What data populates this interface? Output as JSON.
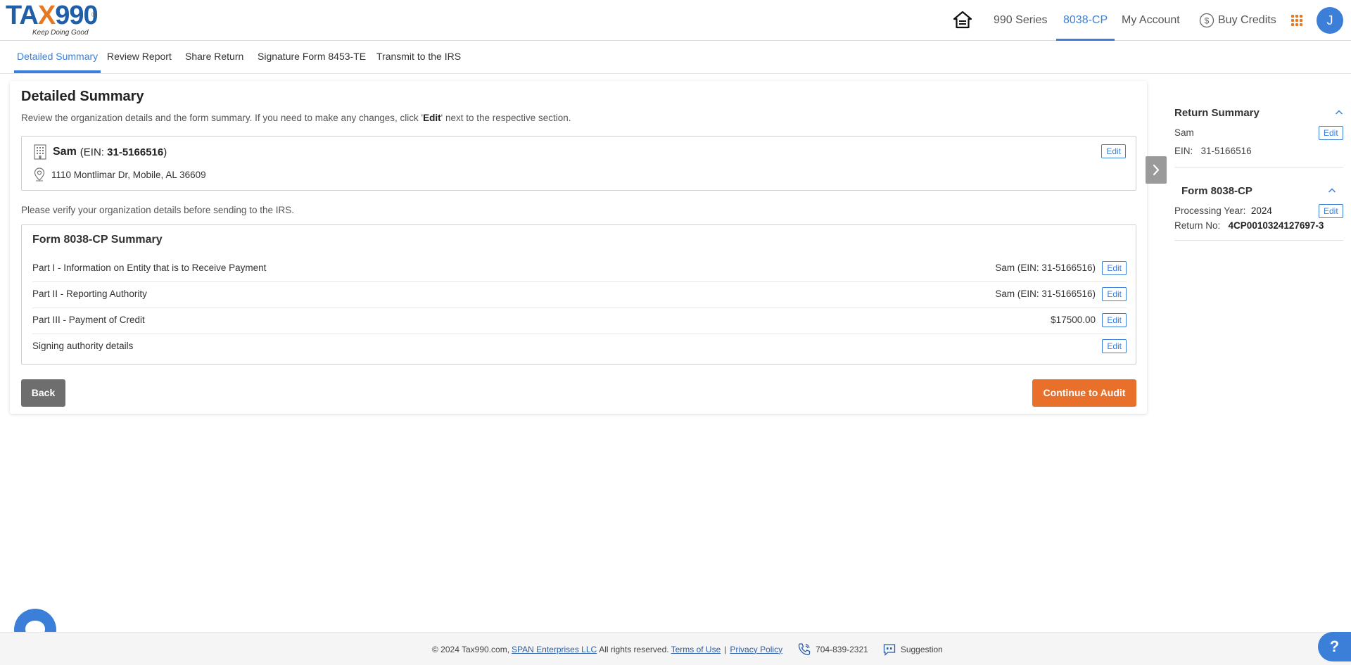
{
  "header": {
    "logo_main_left": "TA",
    "logo_main_x": "X",
    "logo_main_right": "990",
    "logo_reg": "®",
    "logo_tagline": "Keep Doing Good",
    "nav": {
      "series": "990 Series",
      "form": "8038-CP",
      "account": "My Account",
      "credits": "Buy Credits"
    },
    "avatar_initial": "J",
    "accent_color": "#3b7fd8",
    "brand_orange": "#e87722"
  },
  "subnav": {
    "tabs": [
      "Detailed Summary",
      "Review Report",
      "Share Return",
      "Signature Form 8453-TE",
      "Transmit to the IRS"
    ]
  },
  "main": {
    "title": "Detailed Summary",
    "desc_pre": "Review the organization details and the form summary. If you need to make any changes, click '",
    "desc_bold": "Edit",
    "desc_post": "' next to the respective section.",
    "org": {
      "name": "Sam",
      "ein_pre": "(EIN: ",
      "ein": "31-5166516",
      "ein_post": ")",
      "address": "1110 Montlimar Dr, Mobile, AL 36609"
    },
    "edit_label": "Edit",
    "verify_text": "Please verify your organization details before sending to the IRS.",
    "summary": {
      "title": "Form 8038-CP Summary",
      "rows": [
        {
          "label": "Part I - Information on Entity that is to Receive Payment",
          "value": "Sam (EIN: 31-5166516)"
        },
        {
          "label": "Part II - Reporting Authority",
          "value": "Sam (EIN: 31-5166516)"
        },
        {
          "label": "Part III - Payment of Credit",
          "value": "$17500.00"
        },
        {
          "label": "Signing authority details",
          "value": ""
        }
      ]
    },
    "back_label": "Back",
    "continue_label": "Continue to Audit"
  },
  "right_panel": {
    "return_summary_title": "Return Summary",
    "name": "Sam",
    "ein_label": "EIN:",
    "ein_value": "31-5166516",
    "form_title": "Form 8038-CP",
    "year_label": "Processing Year:",
    "year_value": "2024",
    "return_label": "Return No:",
    "return_value": "4CP0010324127697-3",
    "edit_label": "Edit"
  },
  "footer": {
    "copyright": "© 2024 Tax990.com,",
    "company_link": "SPAN Enterprises LLC",
    "rights": "All rights reserved.",
    "terms": "Terms of Use",
    "sep": "|",
    "privacy": "Privacy Policy",
    "phone": "704-839-2321",
    "suggestion": "Suggestion",
    "help": "?"
  }
}
